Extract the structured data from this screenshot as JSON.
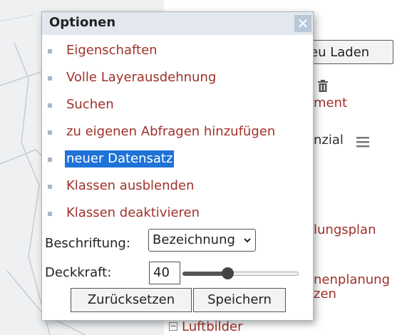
{
  "background_panel": {
    "reload_button_label": "eu Laden",
    "text_items": [
      "ment",
      "nzial",
      "lungsplan",
      "nenplanung",
      "zen",
      "Luftbilder"
    ]
  },
  "dialog": {
    "title": "Optionen",
    "close_label": "✕",
    "menu_items": [
      {
        "label": "Eigenschaften"
      },
      {
        "label": "Volle Layerausdehnung"
      },
      {
        "label": "Suchen"
      },
      {
        "label": "zu eigenen Abfragen hinzufügen"
      },
      {
        "label": "neuer Datensatz"
      },
      {
        "label": "Klassen ausblenden"
      },
      {
        "label": "Klassen deaktivieren"
      }
    ],
    "selected_index": 4,
    "label_field": {
      "label": "Beschriftung:",
      "value": "Bezeichnung"
    },
    "opacity": {
      "label": "Deckkraft:",
      "value": "40",
      "slider_value": 40
    },
    "buttons": {
      "reset": "Zurücksetzen",
      "save": "Speichern"
    }
  },
  "colors": {
    "link": "#a0312a",
    "selection": "#1e72d8",
    "header_bg": "#e3e8ee",
    "close_bg": "#b9c8d8"
  },
  "icons": [
    "trash-icon",
    "hamburger-menu-icon",
    "close-icon",
    "chevron-down-icon",
    "tree-collapse-icon"
  ]
}
